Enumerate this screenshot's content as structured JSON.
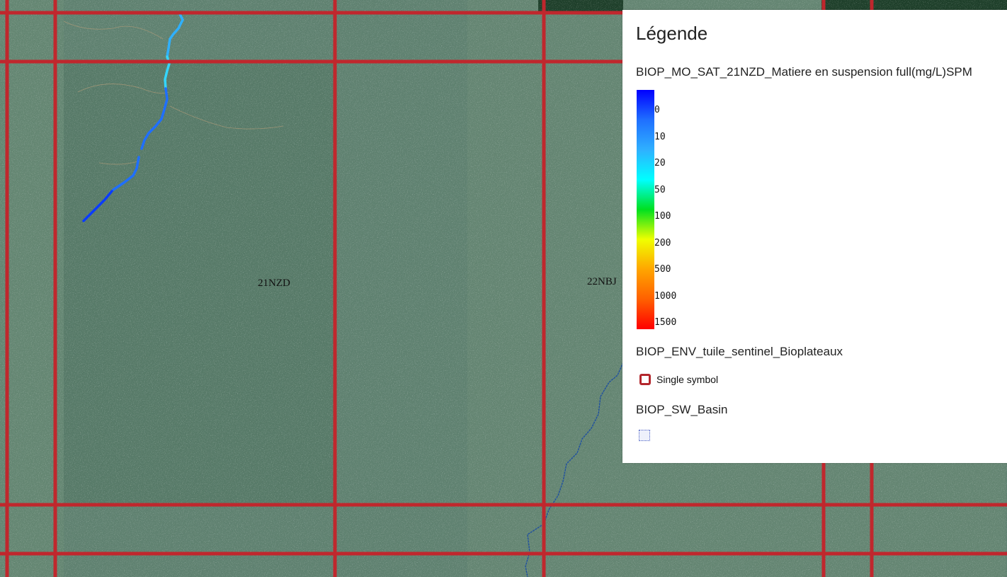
{
  "map": {
    "tile_labels": [
      "21NZD",
      "22NBJ"
    ],
    "grid_color": "#c0272d",
    "river_color": "#1e4fa0"
  },
  "legend": {
    "title": "Légende",
    "layers": [
      {
        "name": "BIOP_MO_SAT_21NZD_Matiere en suspension full(mg/L)SPM",
        "type": "color-ramp",
        "stops": [
          {
            "label": "0",
            "color": "#0000ff"
          },
          {
            "label": "10",
            "color": "#1f6fff"
          },
          {
            "label": "20",
            "color": "#2fb0ff"
          },
          {
            "label": "50",
            "color": "#00ffff"
          },
          {
            "label": "100",
            "color": "#00e020"
          },
          {
            "label": "200",
            "color": "#f0ff00"
          },
          {
            "label": "500",
            "color": "#ffa500"
          },
          {
            "label": "1000",
            "color": "#ff6000"
          },
          {
            "label": "1500",
            "color": "#ff0000"
          }
        ]
      },
      {
        "name": "BIOP_ENV_tuile_sentinel_Bioplateaux",
        "type": "single-symbol",
        "symbol_label": "Single symbol",
        "color": "#b3262c"
      },
      {
        "name": "BIOP_SW_Basin",
        "type": "polygon",
        "color": "#4a5fc4"
      }
    ]
  }
}
